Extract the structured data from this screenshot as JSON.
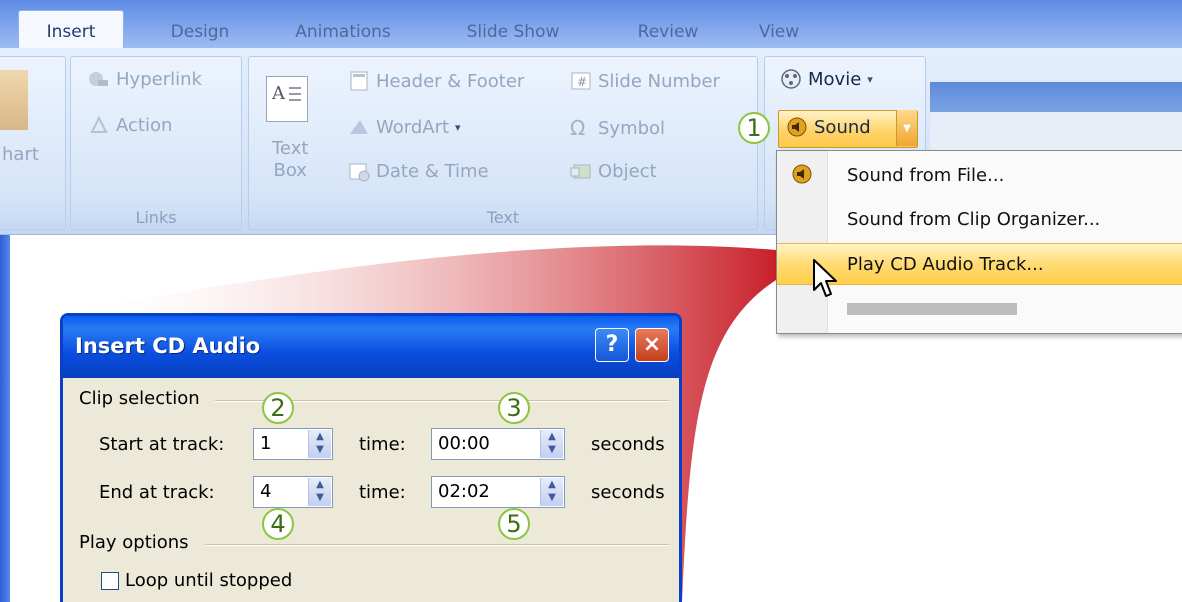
{
  "ribbon": {
    "tabs": [
      {
        "label": "Insert",
        "active": true
      },
      {
        "label": "Design"
      },
      {
        "label": "Animations"
      },
      {
        "label": "Slide Show"
      },
      {
        "label": "Review"
      },
      {
        "label": "View"
      }
    ],
    "partial_left": "hart",
    "links_group": {
      "label": "Links",
      "hyperlink": "Hyperlink",
      "action": "Action"
    },
    "text_group": {
      "label": "Text",
      "text_box": [
        "Text",
        "Box"
      ],
      "header_footer": "Header & Footer",
      "wordart": "WordArt",
      "date_time": "Date & Time",
      "slide_number": "Slide Number",
      "symbol": "Symbol",
      "object": "Object"
    },
    "media_group": {
      "movie": "Movie",
      "sound": "Sound"
    }
  },
  "sound_menu": {
    "items": [
      {
        "label": "Sound from File..."
      },
      {
        "label": "Sound from Clip Organizer..."
      },
      {
        "label": "Play CD Audio Track...",
        "highlighted": true
      }
    ]
  },
  "callouts": [
    "1",
    "2",
    "3",
    "4",
    "5"
  ],
  "dialog": {
    "title": "Insert CD Audio",
    "help_btn": "?",
    "close_btn": "×",
    "clip_selection": {
      "label": "Clip selection",
      "start_label": "Start at track:",
      "start_track": "1",
      "end_label": "End at track:",
      "end_track": "4",
      "time_label": "time:",
      "start_time": "00:00",
      "end_time": "02:02",
      "seconds": "seconds"
    },
    "play_options": {
      "label": "Play options",
      "loop_label": "Loop until stopped"
    }
  },
  "colors": {
    "accent_orange": "#ffc84a",
    "title_blue": "#0a4ee0",
    "callout_green": "#8cc63f",
    "fan_red": "#c8202a"
  }
}
